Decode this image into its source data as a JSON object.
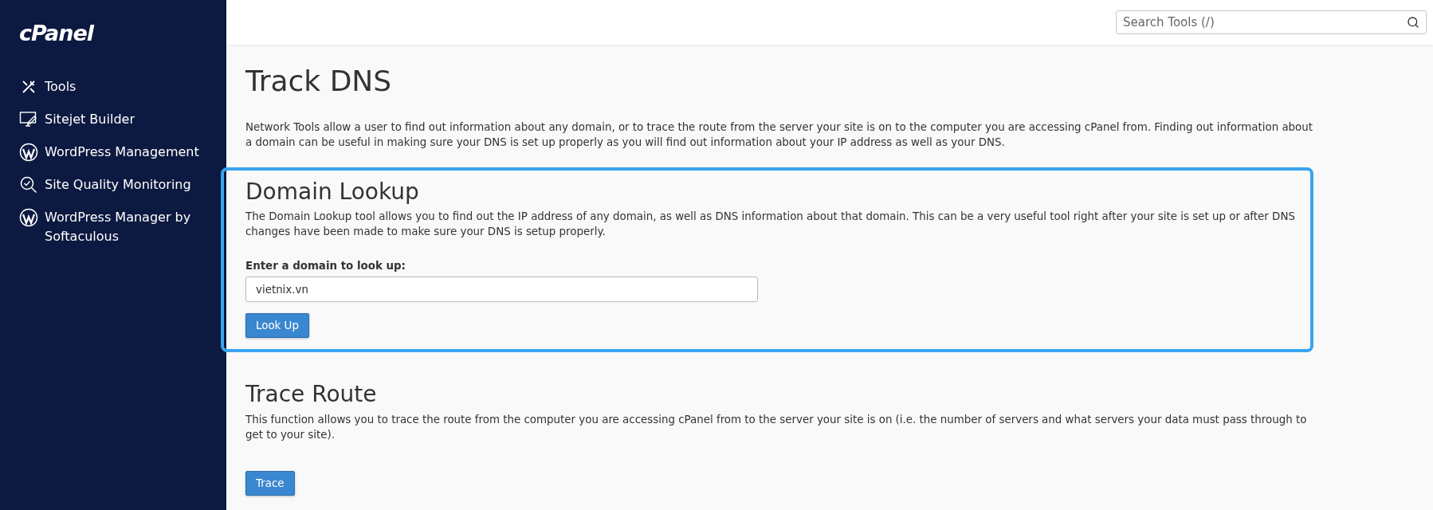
{
  "sidebar": {
    "logo": "cPanel",
    "items": [
      {
        "label": "Tools",
        "kind": "tools"
      },
      {
        "label": "Sitejet Builder",
        "kind": "monitor"
      },
      {
        "label": "WordPress Management",
        "kind": "wordpress"
      },
      {
        "label": "Site Quality Monitoring",
        "kind": "quality"
      },
      {
        "label": "WordPress Manager by Softaculous",
        "kind": "wordpress"
      }
    ]
  },
  "header": {
    "search": {
      "placeholder": "Search Tools (/)"
    }
  },
  "page": {
    "title": "Track DNS",
    "intro": "Network Tools allow a user to find out information about any domain, or to trace the route from the server your site is on to the computer you are accessing cPanel from. Finding out information about a domain can be useful in making sure your DNS is set up properly as you will find out information about your IP address as well as your DNS."
  },
  "sections": [
    {
      "title": "Domain Lookup",
      "highlighted": true,
      "description": "The Domain Lookup tool allows you to find out the IP address of any domain, as well as DNS information about that domain. This can be a very useful tool right after your site is set up or after DNS changes have been made to make sure your DNS is setup properly.",
      "field_label": "Enter a domain to look up:",
      "field_value": "vietnix.vn",
      "button": "Look Up"
    },
    {
      "title": "Trace Route",
      "highlighted": false,
      "description": "This function allows you to trace the route from the computer you are accessing cPanel from to the server your site is on (i.e. the number of servers and what servers your data must pass through to get to your site).",
      "button": "Trace"
    }
  ]
}
